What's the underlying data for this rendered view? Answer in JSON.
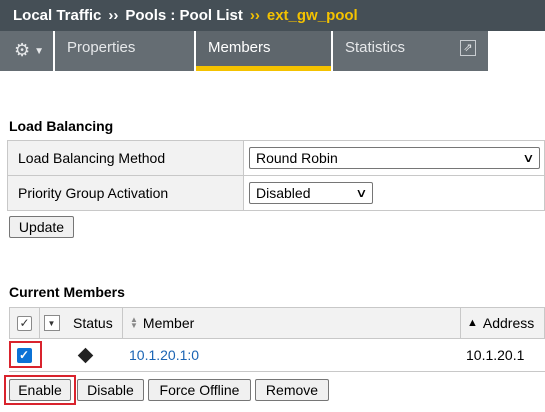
{
  "breadcrumb": {
    "part1": "Local Traffic",
    "sep1": "››",
    "part2": "Pools : Pool List",
    "sep2": "››",
    "current": "ext_gw_pool"
  },
  "tabs": {
    "gear_icon": "⚙",
    "caret_icon": "▼",
    "properties": "Properties",
    "members": "Members",
    "statistics": "Statistics",
    "popout_icon": "⇗"
  },
  "load_balancing": {
    "title": "Load Balancing",
    "method_label": "Load Balancing Method",
    "method_value": "Round Robin",
    "priority_label": "Priority Group Activation",
    "priority_value": "Disabled",
    "update_button": "Update"
  },
  "current_members": {
    "title": "Current Members",
    "columns": {
      "status": "Status",
      "member": "Member",
      "address": "Address",
      "address_sort_icon": "▲"
    },
    "rows": [
      {
        "checked": true,
        "member": "10.1.20.1:0",
        "address": "10.1.20.1"
      }
    ],
    "buttons": {
      "enable": "Enable",
      "disable": "Disable",
      "force_offline": "Force Offline",
      "remove": "Remove"
    }
  },
  "colors": {
    "breadcrumb_bg": "#454f56",
    "tab_bg": "#656d73",
    "accent_yellow": "#f4c200",
    "highlight_red": "#d9232d",
    "link_blue": "#1a64b4"
  }
}
